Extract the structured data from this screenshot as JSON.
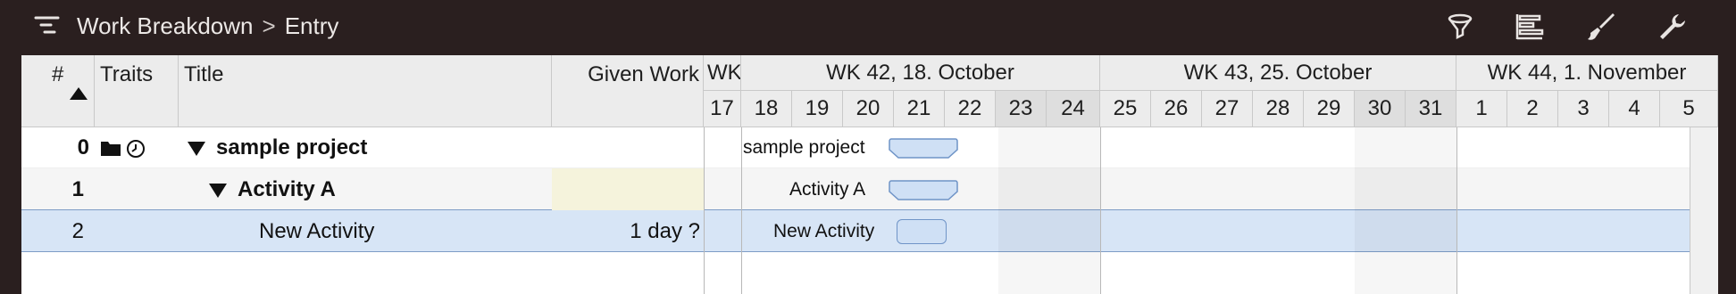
{
  "toolbar": {
    "breadcrumb_root": "Work Breakdown",
    "breadcrumb_sep": ">",
    "breadcrumb_current": "Entry",
    "icons": [
      "outline-icon",
      "filter-icon",
      "gantt-icon",
      "brush-icon",
      "wrench-icon"
    ]
  },
  "table": {
    "columns": {
      "num": "#",
      "traits": "Traits",
      "title": "Title",
      "given_work": "Given Work"
    },
    "rows": [
      {
        "num": "0",
        "title": "sample project",
        "given_work": "",
        "bar_label": "sample project"
      },
      {
        "num": "1",
        "title": "Activity A",
        "given_work": "",
        "bar_label": "Activity A"
      },
      {
        "num": "2",
        "title": "New Activity",
        "given_work": "1 day ?",
        "bar_label": "New Activity"
      }
    ]
  },
  "gantt": {
    "weeks": [
      "WK",
      "WK 42, 18. October",
      "WK 43, 25. October",
      "WK 44, 1. November"
    ],
    "days": [
      "17",
      "18",
      "19",
      "20",
      "21",
      "22",
      "23",
      "24",
      "25",
      "26",
      "27",
      "28",
      "29",
      "30",
      "31",
      "1",
      "2",
      "3",
      "4",
      "5"
    ]
  },
  "colors": {
    "toolbar_bg": "#2a1f1f",
    "selection": "#d7e5f6",
    "bar_fill": "#cfe0f5",
    "bar_stroke": "#6f94c7",
    "given_work_highlight": "#f5f3dc"
  }
}
